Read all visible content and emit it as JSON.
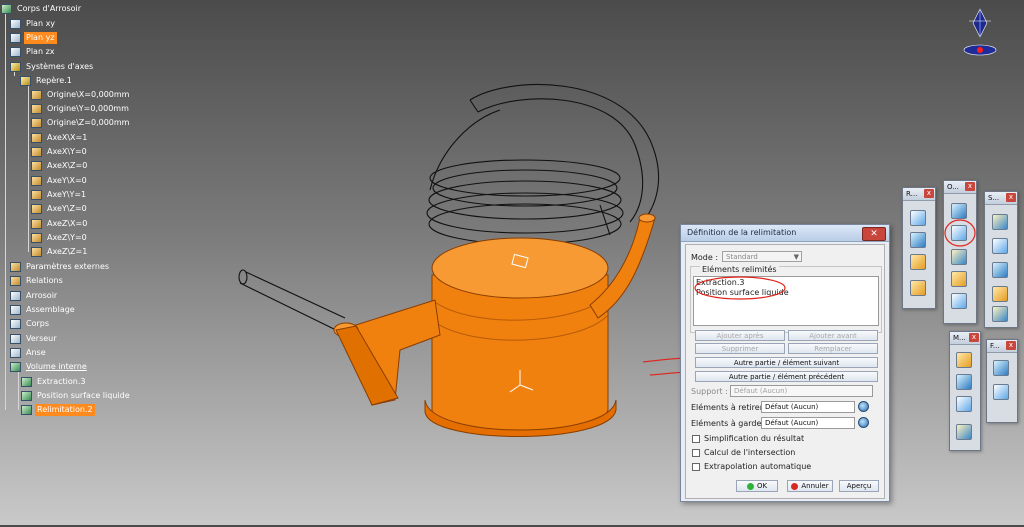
{
  "tree": {
    "root": "Corps d'Arrosoir",
    "items": [
      {
        "label": "Plan xy"
      },
      {
        "label": "Plan yz"
      },
      {
        "label": "Plan zx"
      },
      {
        "label": "Systèmes d'axes"
      },
      {
        "label": "Repère.1"
      },
      {
        "label": "Origine\\X=0,000mm"
      },
      {
        "label": "Origine\\Y=0,000mm"
      },
      {
        "label": "Origine\\Z=0,000mm"
      },
      {
        "label": "AxeX\\X=1"
      },
      {
        "label": "AxeX\\Y=0"
      },
      {
        "label": "AxeX\\Z=0"
      },
      {
        "label": "AxeY\\X=0"
      },
      {
        "label": "AxeY\\Y=1"
      },
      {
        "label": "AxeY\\Z=0"
      },
      {
        "label": "AxeZ\\X=0"
      },
      {
        "label": "AxeZ\\Y=0"
      },
      {
        "label": "AxeZ\\Z=1"
      },
      {
        "label": "Paramètres externes"
      },
      {
        "label": "Relations"
      },
      {
        "label": "Arrosoir"
      },
      {
        "label": "Assemblage"
      },
      {
        "label": "Corps"
      },
      {
        "label": "Verseur"
      },
      {
        "label": "Anse"
      },
      {
        "label": "Volume interne"
      },
      {
        "label": "Extraction.3"
      },
      {
        "label": "Position surface liquide"
      },
      {
        "label": "Relimitation.2"
      }
    ]
  },
  "dialog": {
    "title": "Définition de la relimitation",
    "mode_label": "Mode :",
    "mode_value": "Standard",
    "elements_group": "Eléments relimités",
    "elements": [
      "Extraction.3",
      "Position surface liquide"
    ],
    "btn_ajouter_apres": "Ajouter après",
    "btn_ajouter_avant": "Ajouter avant",
    "btn_supprimer": "Supprimer",
    "btn_remplacer": "Remplacer",
    "btn_autre_suivant": "Autre partie / élément suivant",
    "btn_autre_precedent": "Autre partie / élément précédent",
    "support_label": "Support :",
    "support_value": "Défaut (Aucun)",
    "retirer_label": "Eléments à retirer :",
    "retirer_value": "Défaut (Aucun)",
    "garder_label": "Eléments à garder :",
    "garder_value": "Défaut (Aucun)",
    "chk_simplification": "Simplification du résultat",
    "chk_intersection": "Calcul de l'intersection",
    "chk_extrapolation": "Extrapolation automatique",
    "ok": "OK",
    "annuler": "Annuler",
    "apercu": "Aperçu"
  },
  "toolbars": {
    "t1": "R...",
    "t2": "O...",
    "t3": "S...",
    "t4": "M...",
    "t5": "F..."
  },
  "colors": {
    "selection": "#ff8a1e",
    "model": "#ff8a1e",
    "annotation": "#e2221a"
  }
}
